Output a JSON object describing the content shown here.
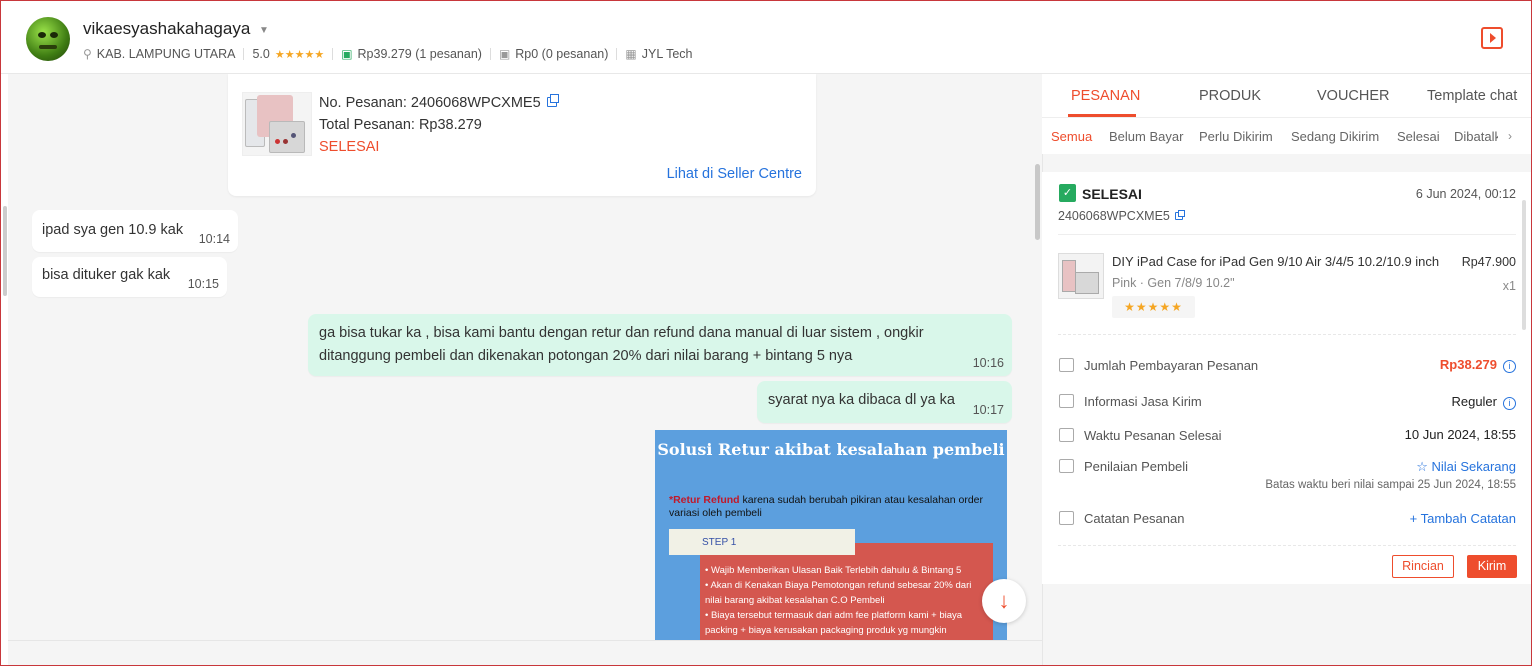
{
  "header": {
    "username": "vikaesyashakahagaya",
    "location": "KAB. LAMPUNG UTARA",
    "rating": "5.0",
    "stars": "★★★★★",
    "paid_total": "Rp39.279 (1 pesanan)",
    "unpaid_total": "Rp0 (0 pesanan)",
    "shop": "JYL Tech"
  },
  "order_card": {
    "order_no": "No. Pesanan: 2406068WPCXME5",
    "total": "Total Pesanan: Rp38.279",
    "status": "SELESAI",
    "link": "Lihat di Seller Centre"
  },
  "messages": [
    {
      "text": "ipad sya gen 10.9 kak",
      "time": "10:14"
    },
    {
      "text": "bisa dituker gak kak",
      "time": "10:15"
    },
    {
      "text": "ga bisa tukar ka , bisa kami bantu dengan retur dan refund dana manual di luar sistem , ongkir ditanggung pembeli dan dikenakan potongan 20% dari nilai barang + bintang 5 nya",
      "time": "10:16"
    },
    {
      "text": "syarat nya ka dibaca dl ya ka",
      "time": "10:17"
    }
  ],
  "image_message": {
    "title": "Solusi Retur akibat kesalahan pembeli",
    "subtitle_strong": "*Retur Refund",
    "subtitle_rest": " karena sudah berubah pikiran atau kesalahan order variasi oleh pembeli",
    "step": "STEP 1",
    "items": [
      "Wajib Memberikan Ulasan Baik Terlebih dahulu & Bintang 5",
      "Akan di Kenakan Biaya Pemotongan refund sebesar 20% dari nilai barang akibat kesalahan C.O Pembeli",
      "Biaya tersebut termasuk dari adm fee platform kami + biaya packing + biaya kerusakan packaging produk yg mungkin"
    ]
  },
  "right_panel": {
    "tabs": [
      "PESANAN",
      "PRODUK",
      "VOUCHER",
      "Template chat"
    ],
    "subtabs": [
      "Semua",
      "Belum Bayar",
      "Perlu Dikirim",
      "Sedang Dikirim",
      "Selesai",
      "Dibatalkan"
    ],
    "order": {
      "status": "SELESAI",
      "date": "6 Jun 2024, 00:12",
      "id": "2406068WPCXME5",
      "product_name": "DIY iPad Case for iPad Gen 9/10 Air 3/4/5 10.2/10.9 inch",
      "product_variant": "Pink · Gen 7/8/9 10.2\"",
      "product_price": "Rp47.900",
      "product_qty": "x1",
      "product_rating": "★★★★★",
      "rows": {
        "payment_label": "Jumlah Pembayaran Pesanan",
        "payment_value": "Rp38.279",
        "shipping_label": "Informasi Jasa Kirim",
        "shipping_value": "Reguler",
        "completed_label": "Waktu Pesanan Selesai",
        "completed_value": "10 Jun 2024, 18:55",
        "review_label": "Penilaian Pembeli",
        "review_value": "☆ Nilai Sekarang",
        "review_note": "Batas waktu beri nilai sampai 25 Jun 2024, 18:55",
        "notes_label": "Catatan Pesanan",
        "notes_value": "+ Tambah Catatan"
      },
      "btn_detail": "Rincian",
      "btn_send": "Kirim"
    }
  },
  "colors": {
    "accent": "#ee4d2d",
    "link": "#2673dd",
    "outgoing_bubble": "#d9f7ea",
    "success": "#26aa5f"
  }
}
